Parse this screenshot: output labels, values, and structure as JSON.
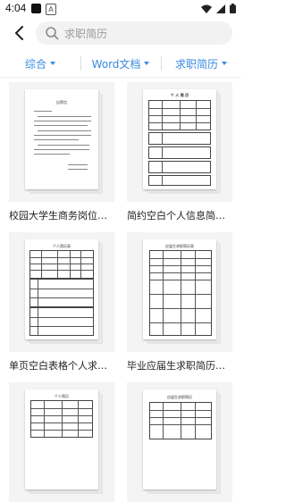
{
  "status": {
    "time": "4:04"
  },
  "search": {
    "placeholder": "求职简历"
  },
  "filters": [
    {
      "label": "综合"
    },
    {
      "label": "Word文档"
    },
    {
      "label": "求职简历"
    }
  ],
  "items": [
    {
      "title": "校园大学生商务岗位自荐信...",
      "doc_heading": "自荐信"
    },
    {
      "title": "简约空白个人信息简历表格...",
      "doc_heading": "个 人 简 历"
    },
    {
      "title": "单页空白表格个人求职简历...",
      "doc_heading": "个人简历表"
    },
    {
      "title": "毕业应届生求职简历空白表...",
      "doc_heading": "应届生求职简历表"
    },
    {
      "title": "",
      "doc_heading": "个人简历"
    },
    {
      "title": "",
      "doc_heading": "应届生求职简历"
    }
  ],
  "colors": {
    "accent": "#3a8be0"
  }
}
